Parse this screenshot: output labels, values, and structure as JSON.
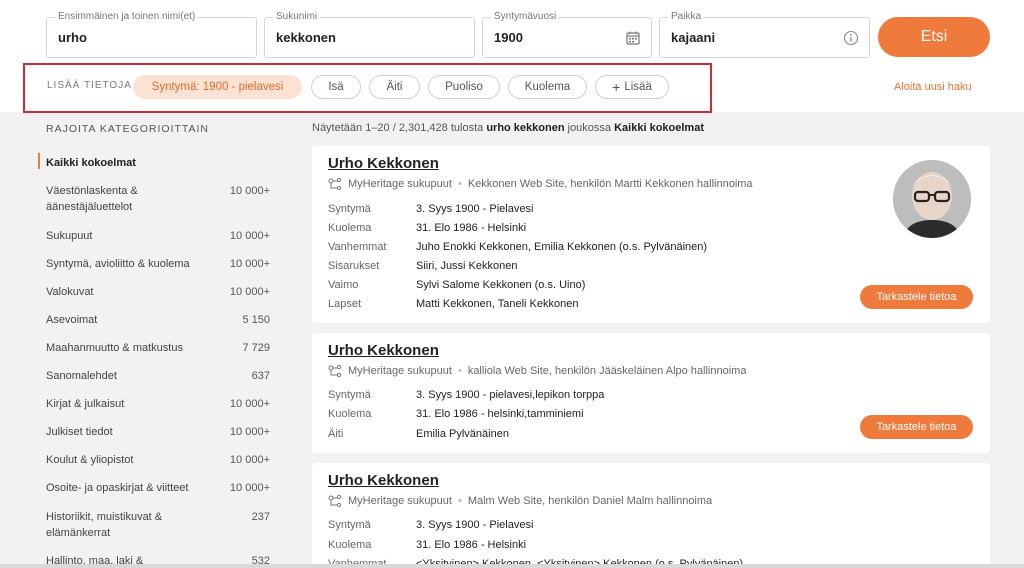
{
  "search": {
    "first_name": {
      "label": "Ensimmäinen ja toinen nimi(et)",
      "value": "urho"
    },
    "last_name": {
      "label": "Sukunimi",
      "value": "kekkonen"
    },
    "birth_year": {
      "label": "Syntymävuosi",
      "value": "1900"
    },
    "place": {
      "label": "Paikka",
      "value": "kajaani"
    },
    "submit_label": "Etsi"
  },
  "more_info": {
    "label": "LISÄÄ TIETOJA",
    "chips": [
      "Syntymä: 1900 - pielavesi",
      "Isä",
      "Äiti",
      "Puoliso",
      "Kuolema",
      "Lisää"
    ],
    "new_search": "Aloita uusi haku"
  },
  "sidebar": {
    "title": "RAJOITA KATEGORIOITTAIN",
    "categories": [
      {
        "name": "Kaikki kokoelmat",
        "count": ""
      },
      {
        "name": "Väestönlaskenta & äänestäjäluettelot",
        "count": "10 000+"
      },
      {
        "name": "Sukupuut",
        "count": "10 000+"
      },
      {
        "name": "Syntymä, avioliitto & kuolema",
        "count": "10 000+"
      },
      {
        "name": "Valokuvat",
        "count": "10 000+"
      },
      {
        "name": "Asevoimat",
        "count": "5 150"
      },
      {
        "name": "Maahanmuutto & matkustus",
        "count": "7 729"
      },
      {
        "name": "Sanomalehdet",
        "count": "637"
      },
      {
        "name": "Kirjat & julkaisut",
        "count": "10 000+"
      },
      {
        "name": "Julkiset tiedot",
        "count": "10 000+"
      },
      {
        "name": "Koulut & yliopistot",
        "count": "10 000+"
      },
      {
        "name": "Osoite- ja opaskirjat & viitteet",
        "count": "10 000+"
      },
      {
        "name": "Historiikit, muistikuvat & elämänkerrat",
        "count": "237"
      },
      {
        "name": "Hallinto, maa, laki & testamentit",
        "count": "532"
      }
    ]
  },
  "results": {
    "summary_prefix": "Näytetään 1–20 / 2,301,428 tulosta",
    "summary_query": "urho kekkonen",
    "summary_mid": "joukossa",
    "summary_scope": "Kaikki kokoelmat",
    "view_label": "Tarkastele tietoa",
    "items": [
      {
        "name": "Urho Kekkonen",
        "source": "MyHeritage sukupuut",
        "site": "Kekkonen Web Site, henkilön Martti Kekkonen hallinnoima",
        "rows": [
          {
            "k": "Syntymä",
            "v": "3. Syys 1900 - Pielavesi"
          },
          {
            "k": "Kuolema",
            "v": "31. Elo 1986 - Helsinki"
          },
          {
            "k": "Vanhemmat",
            "v": "Juho Enokki Kekkonen, Emilia Kekkonen (o.s. Pylvänäinen)"
          },
          {
            "k": "Sisarukset",
            "v": "Siiri, Jussi Kekkonen"
          },
          {
            "k": "Vaimo",
            "v": "Sylvi Salome Kekkonen (o.s. Uino)"
          },
          {
            "k": "Lapset",
            "v": "Matti Kekkonen, Taneli Kekkonen"
          }
        ]
      },
      {
        "name": "Urho Kekkonen",
        "source": "MyHeritage sukupuut",
        "site": "kalliola Web Site, henkilön Jääskeläinen Alpo hallinnoima",
        "rows": [
          {
            "k": "Syntymä",
            "v": "3. Syys 1900 - pielavesi,lepikon torppa"
          },
          {
            "k": "Kuolema",
            "v": "31. Elo 1986 - helsinki,tamminiemi"
          },
          {
            "k": "Äiti",
            "v": "Emilia Pylvänäinen"
          }
        ]
      },
      {
        "name": "Urho Kekkonen",
        "source": "MyHeritage sukupuut",
        "site": "Malm Web Site, henkilön Daniel Malm hallinnoima",
        "rows": [
          {
            "k": "Syntymä",
            "v": "3. Syys 1900 - Pielavesi"
          },
          {
            "k": "Kuolema",
            "v": "31. Elo 1986 - Helsinki"
          },
          {
            "k": "Vanhemmat",
            "v": "<Yksityinen> Kekkonen, <Yksityinen> Kekkonen (o.s. Pylvänäinen)"
          }
        ]
      }
    ]
  },
  "colors": {
    "accent": "#ee7a3c",
    "highlight_border": "#cf2b35",
    "chip_active_bg": "#fbe2d3"
  },
  "icons": [
    "calendar-icon",
    "info-icon",
    "plus-icon",
    "family-tree-icon"
  ]
}
